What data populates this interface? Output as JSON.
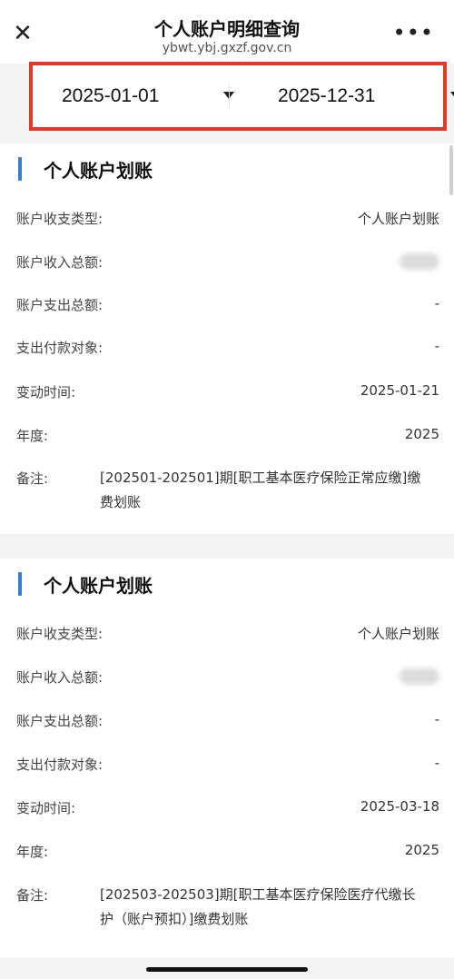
{
  "header": {
    "title": "个人账户明细查询",
    "subtitle": "ybwt.ybj.gxzf.gov.cn",
    "close_icon": "close-icon",
    "more_icon": "more-icon",
    "close_glyph": "✕",
    "more_glyph": "•••"
  },
  "filter": {
    "start_date": "2025-01-01",
    "end_date": "2025-12-31"
  },
  "records": [
    {
      "title": "个人账户划账",
      "type_label": "账户收支类型:",
      "type_value": "个人账户划账",
      "income_label": "账户收入总额:",
      "expense_label": "账户支出总额:",
      "expense_value": "-",
      "payee_label": "支出付款对象:",
      "payee_value": "-",
      "time_label": "变动时间:",
      "time_value": "2025-01-21",
      "year_label": "年度:",
      "year_value": "2025",
      "note_label": "备注:",
      "note_value": "[202501-202501]期[职工基本医疗保险正常应缴]缴费划账"
    },
    {
      "title": "个人账户划账",
      "type_label": "账户收支类型:",
      "type_value": "个人账户划账",
      "income_label": "账户收入总额:",
      "expense_label": "账户支出总额:",
      "expense_value": "-",
      "payee_label": "支出付款对象:",
      "payee_value": "-",
      "time_label": "变动时间:",
      "time_value": "2025-03-18",
      "year_label": "年度:",
      "year_value": "2025",
      "note_label": "备注:",
      "note_value": "[202503-202503]期[职工基本医疗保险医疗代缴长护（账户预扣）]缴费划账"
    }
  ],
  "colors": {
    "accent": "#2f7ee0",
    "highlight_border": "#e23a2a"
  }
}
